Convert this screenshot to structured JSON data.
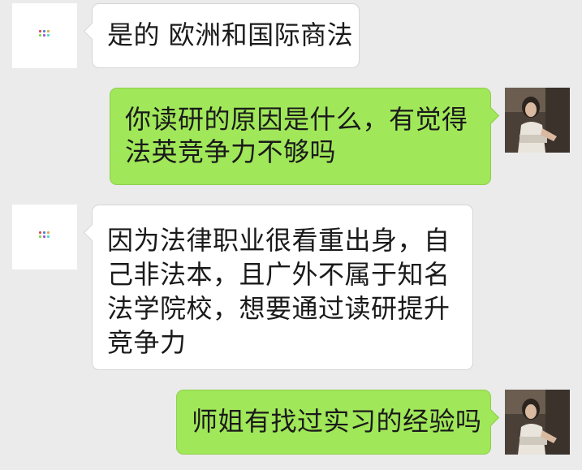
{
  "contact": {
    "avatar_icon": "app-logo-icon",
    "avatar_colors": [
      "#d94f4f",
      "#4f7fd9",
      "#d9a84f",
      "#7fd94f",
      "#a84fd9",
      "#4fd9c8"
    ]
  },
  "me": {
    "avatar_icon": "user-photo-avatar",
    "avatar_colors": [
      "#4a4038",
      "#e9e4dc",
      "#2b241f"
    ]
  },
  "colors": {
    "background": "#ebebeb",
    "incoming_bubble": "#ffffff",
    "outgoing_bubble": "#a0e759",
    "text": "#1a1a1a"
  },
  "messages": [
    {
      "side": "in",
      "text": "是的 欧洲和国际商法"
    },
    {
      "side": "out",
      "text": "你读研的原因是什么，有觉得法英竞争力不够吗"
    },
    {
      "side": "in",
      "text": "因为法律职业很看重出身，自己非法本，且广外不属于知名法学院校，想要通过读研提升竞争力"
    },
    {
      "side": "out",
      "text": "师姐有找过实习的经验吗"
    }
  ]
}
